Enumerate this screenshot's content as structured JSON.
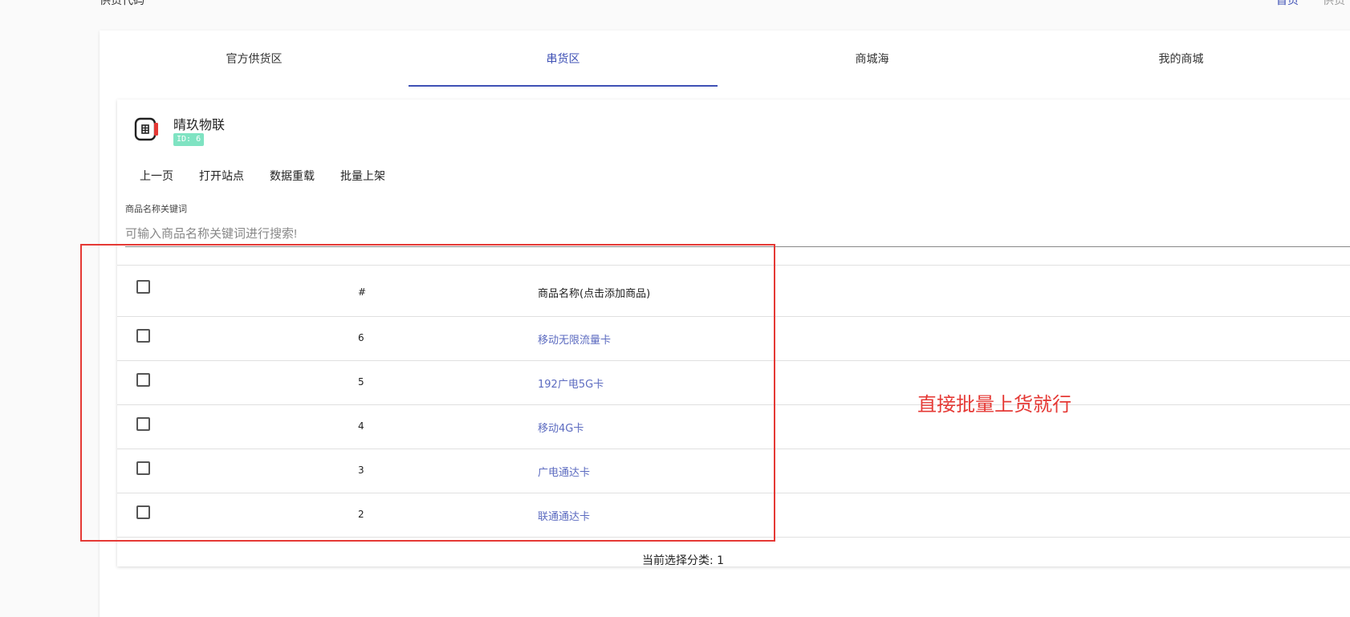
{
  "header": {
    "title": "供货代码",
    "link_primary": "首页",
    "link_secondary": "供货"
  },
  "tabs": [
    {
      "label": "官方供货区",
      "active": false
    },
    {
      "label": "串货区",
      "active": true
    },
    {
      "label": "商城海",
      "active": false
    },
    {
      "label": "我的商城",
      "active": false
    }
  ],
  "site": {
    "name": "晴玖物联",
    "id_badge": "ID: 6",
    "icon": "sim-card-icon"
  },
  "toolbar": {
    "prev_page": "上一页",
    "open_site": "打开站点",
    "reload_data": "数据重载",
    "batch_list": "批量上架"
  },
  "search": {
    "label": "商品名称关键词",
    "placeholder": "可输入商品名称关键词进行搜索!",
    "value": ""
  },
  "table": {
    "columns": {
      "num": "#",
      "name": "商品名称(点击添加商品)"
    },
    "rows": [
      {
        "num": "6",
        "name": "移动无限流量卡",
        "checked": false
      },
      {
        "num": "5",
        "name": "192广电5G卡",
        "checked": false
      },
      {
        "num": "4",
        "name": "移动4G卡",
        "checked": false
      },
      {
        "num": "3",
        "name": "广电通达卡",
        "checked": false
      },
      {
        "num": "2",
        "name": "联通通达卡",
        "checked": false
      }
    ]
  },
  "status": {
    "text": "当前选择分类: 1"
  },
  "annotation": {
    "text": "直接批量上货就行",
    "color": "#e53935"
  },
  "colors": {
    "accent": "#3f51b5",
    "link": "#5c6bc0",
    "badge": "#7fe3c2"
  }
}
